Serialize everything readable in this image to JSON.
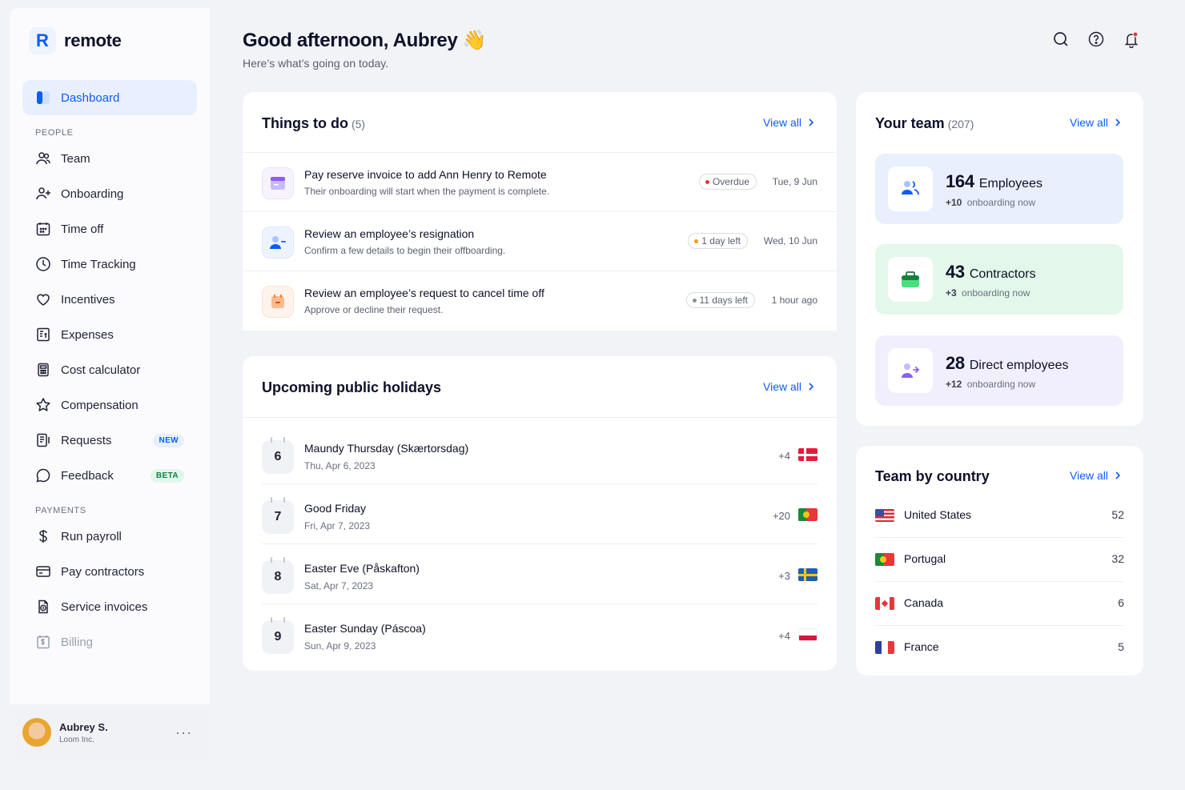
{
  "brand": {
    "name": "remote",
    "logo_letter": "R"
  },
  "sidebar": {
    "items": [
      {
        "label": "Dashboard",
        "icon": "dashboard-icon",
        "active": true
      },
      {
        "section": "PEOPLE"
      },
      {
        "label": "Team",
        "icon": "team-icon"
      },
      {
        "label": "Onboarding",
        "icon": "onboarding-icon"
      },
      {
        "label": "Time off",
        "icon": "calendar-icon"
      },
      {
        "label": "Time Tracking",
        "icon": "clock-icon"
      },
      {
        "label": "Incentives",
        "icon": "heart-icon"
      },
      {
        "label": "Expenses",
        "icon": "receipt-icon"
      },
      {
        "label": "Cost calculator",
        "icon": "calculator-icon"
      },
      {
        "label": "Compensation",
        "icon": "star-icon"
      },
      {
        "label": "Requests",
        "icon": "requests-icon",
        "badge": "NEW"
      },
      {
        "label": "Feedback",
        "icon": "chat-icon",
        "badge": "BETA"
      },
      {
        "section": "PAYMENTS"
      },
      {
        "label": "Run payroll",
        "icon": "dollar-icon"
      },
      {
        "label": "Pay contractors",
        "icon": "card-icon"
      },
      {
        "label": "Service invoices",
        "icon": "invoice-icon"
      },
      {
        "label": "Billing",
        "icon": "billing-icon"
      }
    ]
  },
  "user": {
    "name": "Aubrey S.",
    "org": "Loom Inc.",
    "more": "···"
  },
  "header": {
    "greeting": "Good afternoon, Aubrey",
    "wave": "👋",
    "subtitle": "Here’s what’s going on today."
  },
  "todo": {
    "title": "Things to do",
    "count": "(5)",
    "view_all": "View all",
    "items": [
      {
        "title": "Pay reserve invoice to add Ann Henry to Remote",
        "subtitle": "Their onboarding will start when the payment is complete.",
        "status": "Overdue",
        "status_color": "#e5383b",
        "date": "Tue, 9 Jun",
        "icon": "invoice-card-icon"
      },
      {
        "title": "Review an employee’s resignation",
        "subtitle": "Confirm a few details to begin their offboarding.",
        "status": "1 day left",
        "status_color": "#f59e0b",
        "date": "Wed, 10 Jun",
        "icon": "person-minus-icon"
      },
      {
        "title": "Review an employee’s request to cancel time off",
        "subtitle": "Approve or decline their request.",
        "status": "11 days left",
        "status_color": "#8a8f9c",
        "date": "1 hour ago",
        "icon": "calendar-cancel-icon"
      }
    ]
  },
  "holidays": {
    "title": "Upcoming public holidays",
    "view_all": "View all",
    "items": [
      {
        "day": "6",
        "name": "Maundy Thursday (Skærtorsdag)",
        "date": "Thu, Apr 6, 2023",
        "extra": "+4",
        "flag": "denmark"
      },
      {
        "day": "7",
        "name": "Good Friday",
        "date": "Fri, Apr 7, 2023",
        "extra": "+20",
        "flag": "portugal"
      },
      {
        "day": "8",
        "name": "Easter Eve (Påskafton)",
        "date": "Sat, Apr 7, 2023",
        "extra": "+3",
        "flag": "sweden"
      },
      {
        "day": "9",
        "name": "Easter Sunday (Páscoa)",
        "date": "Sun, Apr 9, 2023",
        "extra": "+4",
        "flag": "poland"
      }
    ]
  },
  "team": {
    "title": "Your team",
    "count": "(207)",
    "view_all": "View all",
    "tiles": [
      {
        "num": "164",
        "label": "Employees",
        "delta": "+10",
        "sub": "onboarding now",
        "bg": "#e8f0fe"
      },
      {
        "num": "43",
        "label": "Contractors",
        "delta": "+3",
        "sub": "onboarding now",
        "bg": "#e3f8ea"
      },
      {
        "num": "28",
        "label": "Direct employees",
        "delta": "+12",
        "sub": "onboarding now",
        "bg": "#f1effd"
      }
    ]
  },
  "countries": {
    "title": "Team by country",
    "view_all": "View all",
    "items": [
      {
        "name": "United States",
        "count": "52",
        "flag": "usa"
      },
      {
        "name": "Portugal",
        "count": "32",
        "flag": "portugal"
      },
      {
        "name": "Canada",
        "count": "6",
        "flag": "canada"
      },
      {
        "name": "France",
        "count": "5",
        "flag": "france"
      }
    ]
  },
  "colors": {
    "accent": "#0b5cff",
    "text": "#0d1028",
    "muted": "#6b7080"
  }
}
